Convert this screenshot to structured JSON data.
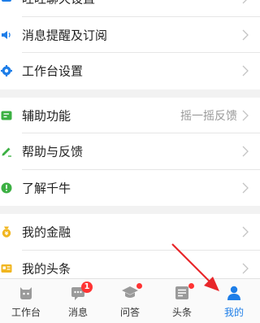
{
  "settings": {
    "group1": [
      {
        "label": "旺旺聊天设置",
        "icon": "chat-settings-icon"
      },
      {
        "label": "消息提醒及订阅",
        "icon": "speaker-icon"
      },
      {
        "label": "工作台设置",
        "icon": "gear-icon"
      }
    ],
    "group2": [
      {
        "label": "辅助功能",
        "icon": "assist-icon",
        "extra": "摇一摇反馈"
      },
      {
        "label": "帮助与反馈",
        "icon": "pencil-icon"
      },
      {
        "label": "了解千牛",
        "icon": "info-icon"
      }
    ],
    "group3": [
      {
        "label": "我的金融",
        "icon": "finance-icon"
      },
      {
        "label": "我的头条",
        "icon": "headline-card-icon"
      }
    ]
  },
  "tabbar": {
    "tabs": [
      {
        "label": "工作台",
        "icon": "workbench-icon"
      },
      {
        "label": "消息",
        "icon": "message-icon",
        "badge": "1"
      },
      {
        "label": "问答",
        "icon": "qa-icon"
      },
      {
        "label": "头条",
        "icon": "headline-icon"
      },
      {
        "label": "我的",
        "icon": "user-icon"
      }
    ],
    "active_index": 4
  },
  "colors": {
    "accent": "#1e7ee8",
    "green": "#3cb043",
    "gold": "#f1b620",
    "badge": "#ff3333",
    "arrow": "#e8262a"
  }
}
